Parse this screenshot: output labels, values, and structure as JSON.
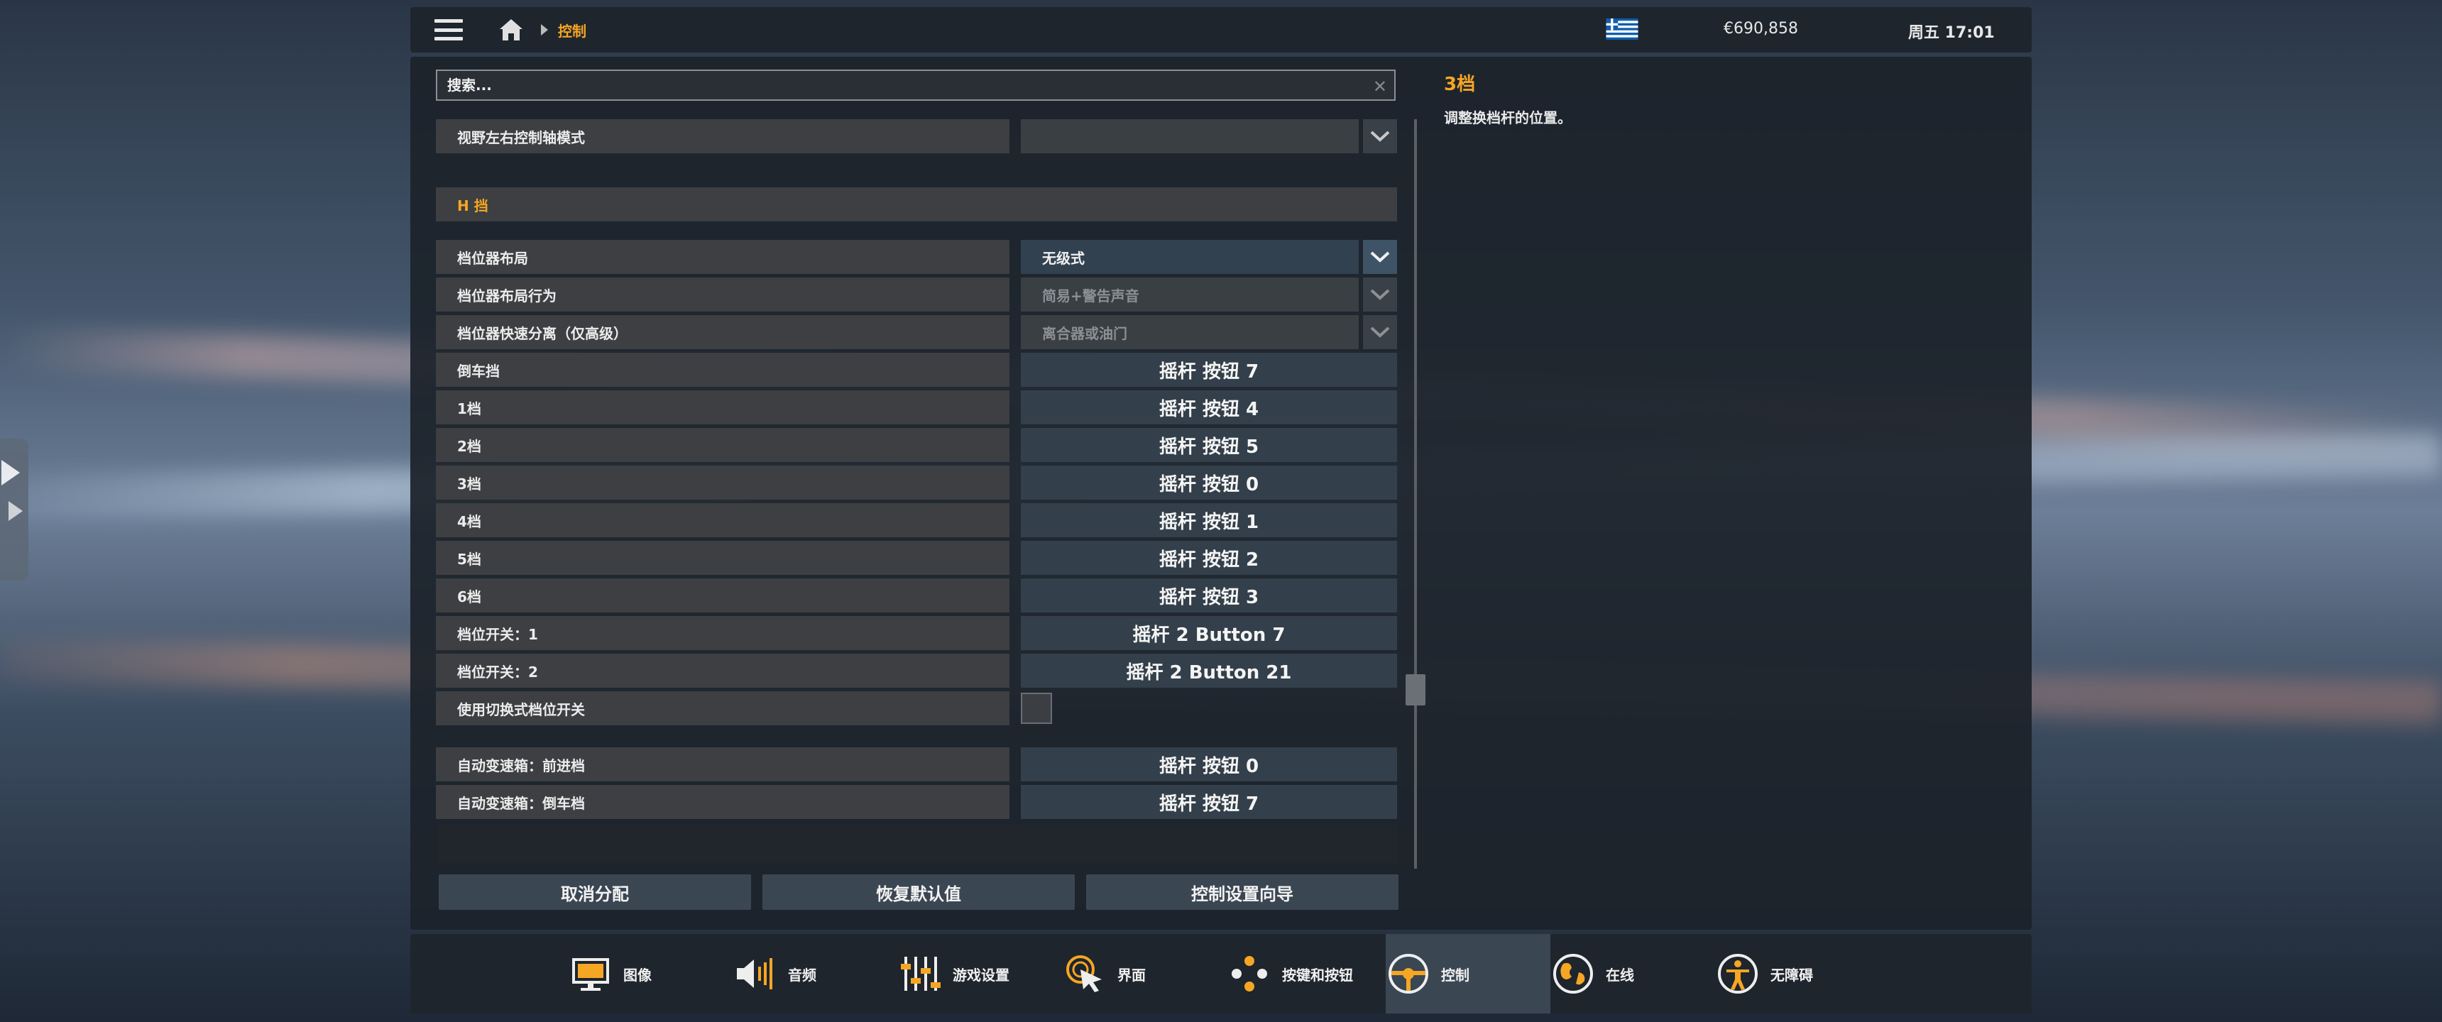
{
  "topbar": {
    "breadcrumb": "控制",
    "money": "€690,858",
    "clock": "周五 17:01"
  },
  "search": {
    "placeholder": "搜索..."
  },
  "settings": {
    "view_axis_label": "视野左右控制轴模式",
    "view_axis_value": "",
    "h_section": "H 挡",
    "rows": [
      {
        "label": "档位器布局",
        "value": "无级式"
      },
      {
        "label": "档位器布局行为",
        "value": "简易+警告声音"
      },
      {
        "label": "档位器快速分离（仅高级）",
        "value": "离合器或油门"
      },
      {
        "label": "倒车挡",
        "value": "摇杆 按钮 7"
      },
      {
        "label": "1档",
        "value": "摇杆 按钮 4"
      },
      {
        "label": "2档",
        "value": "摇杆 按钮 5"
      },
      {
        "label": "3档",
        "value": "摇杆 按钮 0"
      },
      {
        "label": "4档",
        "value": "摇杆 按钮 1"
      },
      {
        "label": "5档",
        "value": "摇杆 按钮 2"
      },
      {
        "label": "6档",
        "value": "摇杆 按钮 3"
      },
      {
        "label": "档位开关：1",
        "value": "摇杆 2 Button 7"
      },
      {
        "label": "档位开关：2",
        "value": "摇杆 2 Button 21"
      },
      {
        "label": "使用切换式档位开关",
        "value": ""
      },
      {
        "label": "自动变速箱：前进档",
        "value": "摇杆 按钮 0"
      },
      {
        "label": "自动变速箱：倒车档",
        "value": "摇杆 按钮 7"
      }
    ]
  },
  "footer_buttons": {
    "unassign": "取消分配",
    "restore": "恢复默认值",
    "wizard": "控制设置向导"
  },
  "help": {
    "title": "3档",
    "text": "调整换档杆的位置。"
  },
  "nav": {
    "items": [
      {
        "label": "图像",
        "icon": "monitor-icon"
      },
      {
        "label": "音频",
        "icon": "speaker-icon"
      },
      {
        "label": "游戏设置",
        "icon": "sliders-icon"
      },
      {
        "label": "界面",
        "icon": "cursor-icon"
      },
      {
        "label": "按键和按钮",
        "icon": "buttons-icon"
      },
      {
        "label": "控制",
        "icon": "steering-wheel-icon"
      },
      {
        "label": "在线",
        "icon": "globe-icon"
      },
      {
        "label": "无障碍",
        "icon": "accessibility-icon"
      }
    ],
    "active": "控制"
  },
  "colors": {
    "accent": "#f5a623",
    "panel": "#1f252d",
    "binding": "#333f4a"
  }
}
